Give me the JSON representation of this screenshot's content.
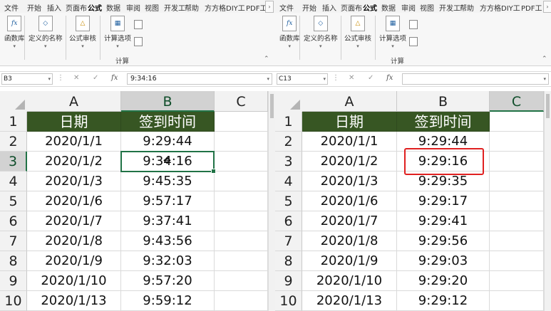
{
  "ribbon_tabs": [
    "文件",
    "开始",
    "插入",
    "页面布",
    "公式",
    "数据",
    "审阅",
    "视图",
    "开发工",
    "帮助",
    "方方格",
    "DIY工",
    "PDF工"
  ],
  "active_tab": "公式",
  "scroll_arrow_glyph": "›",
  "ribbon": {
    "function_library": "函数库",
    "defined_names": "定义的名称",
    "formula_auditing": "公式审核",
    "calc_options": "计算选项",
    "calculation_group": "计算"
  },
  "formula_bar": {
    "cancel_glyph": "✕",
    "enter_glyph": "✓",
    "fx_label": "fx"
  },
  "column_headers": [
    "A",
    "B",
    "C"
  ],
  "row_numbers": [
    "1",
    "2",
    "3",
    "4",
    "5",
    "6",
    "7",
    "8",
    "9",
    "10"
  ],
  "table_headers": [
    "日期",
    "签到时间"
  ],
  "left": {
    "name_box": "B3",
    "formula_value": "9:34:16",
    "rows": [
      [
        "2020/1/1",
        "9:29:44"
      ],
      [
        "2020/1/2",
        "9:34:16"
      ],
      [
        "2020/1/3",
        "9:45:35"
      ],
      [
        "2020/1/6",
        "9:57:17"
      ],
      [
        "2020/1/7",
        "9:37:41"
      ],
      [
        "2020/1/8",
        "9:43:56"
      ],
      [
        "2020/1/9",
        "9:32:03"
      ],
      [
        "2020/1/10",
        "9:57:20"
      ],
      [
        "2020/1/13",
        "9:59:12"
      ]
    ]
  },
  "right": {
    "name_box": "C13",
    "formula_value": "",
    "rows": [
      [
        "2020/1/1",
        "9:29:44"
      ],
      [
        "2020/1/2",
        "9:29:16"
      ],
      [
        "2020/1/3",
        "9:29:35"
      ],
      [
        "2020/1/6",
        "9:29:17"
      ],
      [
        "2020/1/7",
        "9:29:41"
      ],
      [
        "2020/1/8",
        "9:29:56"
      ],
      [
        "2020/1/9",
        "9:29:03"
      ],
      [
        "2020/1/10",
        "9:29:20"
      ],
      [
        "2020/1/13",
        "9:29:12"
      ]
    ]
  },
  "colors": {
    "header_fill": "#375623",
    "excel_green": "#217346",
    "highlight_red": "#e02020"
  }
}
